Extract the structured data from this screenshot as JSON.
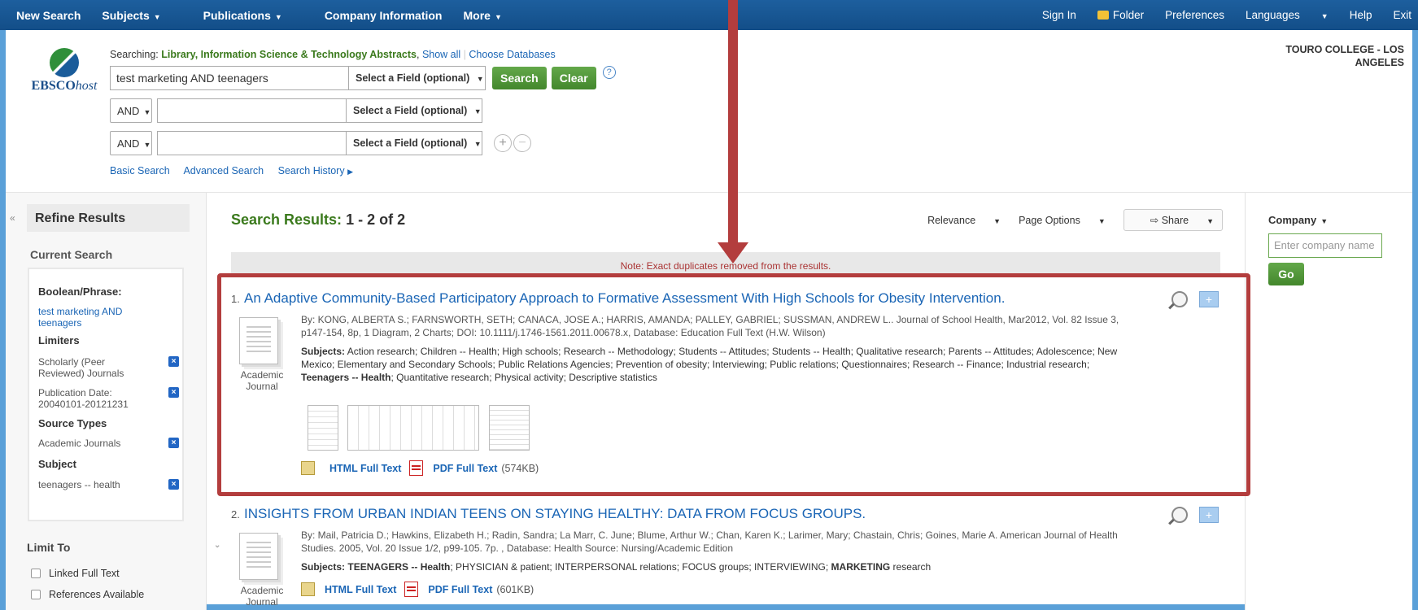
{
  "nav": {
    "left": [
      "New Search",
      "Subjects",
      "Publications",
      "Company Information",
      "More"
    ],
    "right": [
      "Sign In",
      "Folder",
      "Preferences",
      "Languages",
      "Help",
      "Exit"
    ]
  },
  "logo": {
    "text_a": "EBSCO",
    "text_b": "host"
  },
  "searching": {
    "prefix": "Searching:",
    "db": "Library, Information Science & Technology Abstracts",
    "show_all": "Show all",
    "choose": "Choose Databases"
  },
  "search": {
    "query1": "test marketing AND teenagers",
    "field_label": "Select a Field (optional)",
    "bool": "AND",
    "search_btn": "Search",
    "clear_btn": "Clear",
    "help": "?"
  },
  "links": [
    "Basic Search",
    "Advanced Search",
    "Search History"
  ],
  "institution": {
    "line1": "TOURO COLLEGE - LOS",
    "line2": "ANGELES"
  },
  "sidebar": {
    "collapse": "«",
    "refine": "Refine Results",
    "current_search": "Current Search",
    "boolean_head": "Boolean/Phrase:",
    "boolean_val": "test marketing AND teenagers",
    "limiters_head": "Limiters",
    "limiter1": "Scholarly (Peer Reviewed) Journals",
    "limiter2": "Publication Date: 20040101-20121231",
    "source_head": "Source Types",
    "source1": "Academic Journals",
    "subject_head": "Subject",
    "subject1": "teenagers -- health",
    "limit_to": "Limit To",
    "cb1": "Linked Full Text",
    "cb2": "References Available"
  },
  "results": {
    "label": "Search Results:",
    "count": "1 - 2 of 2",
    "relevance": "Relevance",
    "page_options": "Page Options",
    "share": "Share",
    "note": "Note: Exact duplicates removed from the results.",
    "items": [
      {
        "num": "1.",
        "title": "An Adaptive Community-Based Participatory Approach to Formative Assessment With High Schools for Obesity Intervention.",
        "type_a": "Academic",
        "type_b": "Journal",
        "by": "By: KONG, ALBERTA S.; FARNSWORTH, SETH; CANACA, JOSE A.; HARRIS, AMANDA; PALLEY, GABRIEL; SUSSMAN, ANDREW L.. Journal of School Health, Mar2012, Vol. 82 Issue 3, p147-154, 8p, 1 Diagram, 2 Charts; DOI: 10.1111/j.1746-1561.2011.00678.x, Database: Education Full Text (H.W. Wilson)",
        "subj_label": "Subjects:",
        "subj_text": "Action research; Children -- Health; High schools; Research -- Methodology; Students -- Attitudes; Students -- Health; Qualitative research; Parents -- Attitudes; Adolescence; New Mexico; Elementary and Secondary Schools; Public Relations Agencies; Prevention of obesity; Interviewing; Public relations; Questionnaires; Research -- Finance; Industrial research;",
        "subj_bold": "Teenagers -- Health",
        "subj_text2": "; Quantitative research; Physical activity; Descriptive statistics",
        "html": "HTML Full Text",
        "pdf": "PDF Full Text",
        "size": "(574KB)"
      },
      {
        "num": "2.",
        "title": "INSIGHTS FROM URBAN INDIAN TEENS ON STAYING HEALTHY: DATA FROM FOCUS GROUPS.",
        "type_a": "Academic",
        "type_b": "Journal",
        "by": "By: Mail, Patricia D.; Hawkins, Elizabeth H.; Radin, Sandra; La Marr, C. June; Blume, Arthur W.; Chan, Karen K.; Larimer, Mary; Chastain, Chris; Goines, Marie A. American Journal of Health Studies. 2005, Vol. 20 Issue 1/2, p99-105. 7p. , Database: Health Source: Nursing/Academic Edition",
        "subj_label": "Subjects:",
        "subj_bold": "TEENAGERS -- Health",
        "subj_text": "; PHYSICIAN & patient; INTERPERSONAL relations; FOCUS groups; INTERVIEWING;",
        "subj_bold2": "MARKETING",
        "subj_text2": " research",
        "html": "HTML Full Text",
        "pdf": "PDF Full Text",
        "size": "(601KB)"
      }
    ]
  },
  "company": {
    "label": "Company",
    "placeholder": "Enter company name",
    "go": "Go"
  },
  "colors": {
    "nav": "#134e88",
    "accent_green": "#43872c",
    "highlight": "#b33d3d",
    "link": "#1a65b5"
  }
}
